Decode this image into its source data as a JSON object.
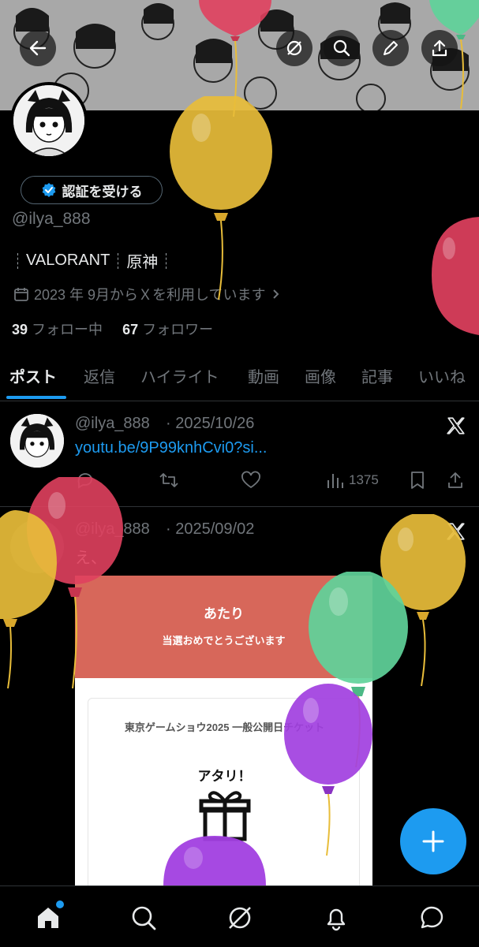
{
  "profile": {
    "verify_button": "認証を受ける",
    "handle": "@ilya_888",
    "bio_items": [
      "VALORANT",
      "原神"
    ],
    "joined": "2023 年 9月からＸを利用しています",
    "following_count": "39",
    "following_label": "フォロー中",
    "followers_count": "67",
    "followers_label": "フォロワー"
  },
  "tabs": [
    "ポスト",
    "返信",
    "ハイライト",
    "動画",
    "画像",
    "記事",
    "いいね"
  ],
  "posts": [
    {
      "author": "@ilya_888",
      "date": "· 2025/10/26",
      "link": "youtu.be/9P99knhCvi0?si...",
      "views": "1375"
    },
    {
      "author": "@ilya_888",
      "date": "· 2025/09/02",
      "text": "え、",
      "card": {
        "title": "あたり",
        "subtitle": "当選おめでとうございます",
        "event": "東京ゲームショウ2025 一般公開日チケット",
        "prize": "アタリ！"
      }
    }
  ],
  "colors": {
    "accent": "#1d9bf0",
    "card_header": "#d7675a",
    "balloon_red": "#e0405e",
    "balloon_yellow": "#e8bd3a",
    "balloon_green": "#5fd39a",
    "balloon_purple": "#a13fe0"
  },
  "icons": [
    "back-arrow-icon",
    "grok-icon",
    "search-icon",
    "edit-icon",
    "share-icon",
    "verified-icon",
    "calendar-icon",
    "chevron-right-icon",
    "x-logo-icon",
    "reply-icon",
    "repost-icon",
    "like-icon",
    "views-icon",
    "bookmark-icon",
    "compose-icon",
    "home-icon",
    "notifications-icon",
    "messages-icon",
    "gift-icon"
  ]
}
